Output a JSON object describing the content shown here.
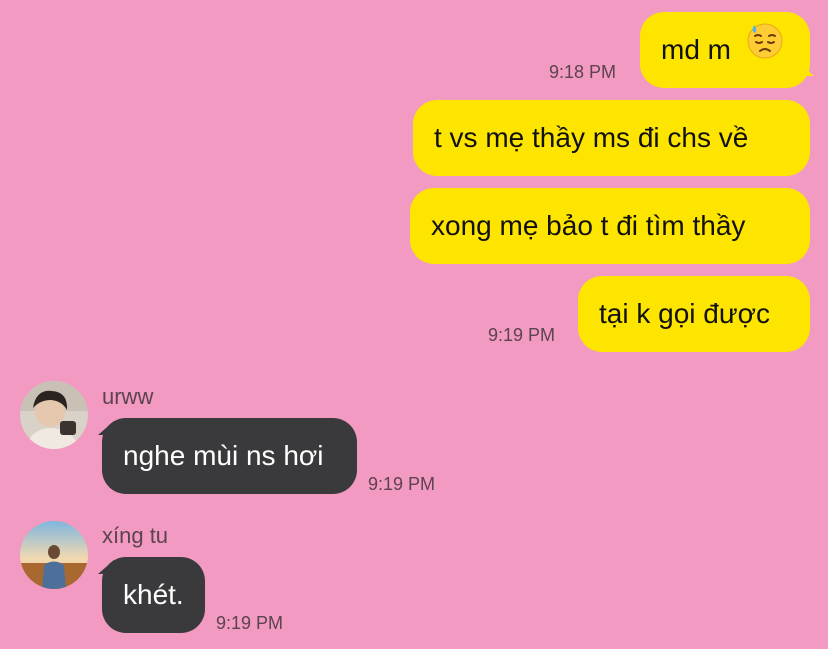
{
  "colors": {
    "background": "#f29ac2",
    "outgoing_bubble": "#fee500",
    "incoming_bubble": "#3a3a3c",
    "timestamp": "#5c4350",
    "sender_name": "#5c4350"
  },
  "messages": [
    {
      "direction": "outgoing",
      "text": "md m",
      "emoji": "downcast-face-with-sweat",
      "time": "9:18 PM"
    },
    {
      "direction": "outgoing",
      "text": "t vs mẹ thầy ms đi chs về",
      "time": ""
    },
    {
      "direction": "outgoing",
      "text": "xong mẹ bảo t đi tìm thầy",
      "time": ""
    },
    {
      "direction": "outgoing",
      "text": "tại k gọi được",
      "time": "9:19 PM"
    },
    {
      "direction": "incoming",
      "sender": "urww",
      "text": "nghe mùi ns hơi",
      "time": "9:19 PM"
    },
    {
      "direction": "incoming",
      "sender": "xíng tu",
      "text": "khét.",
      "time": "9:19 PM"
    }
  ]
}
